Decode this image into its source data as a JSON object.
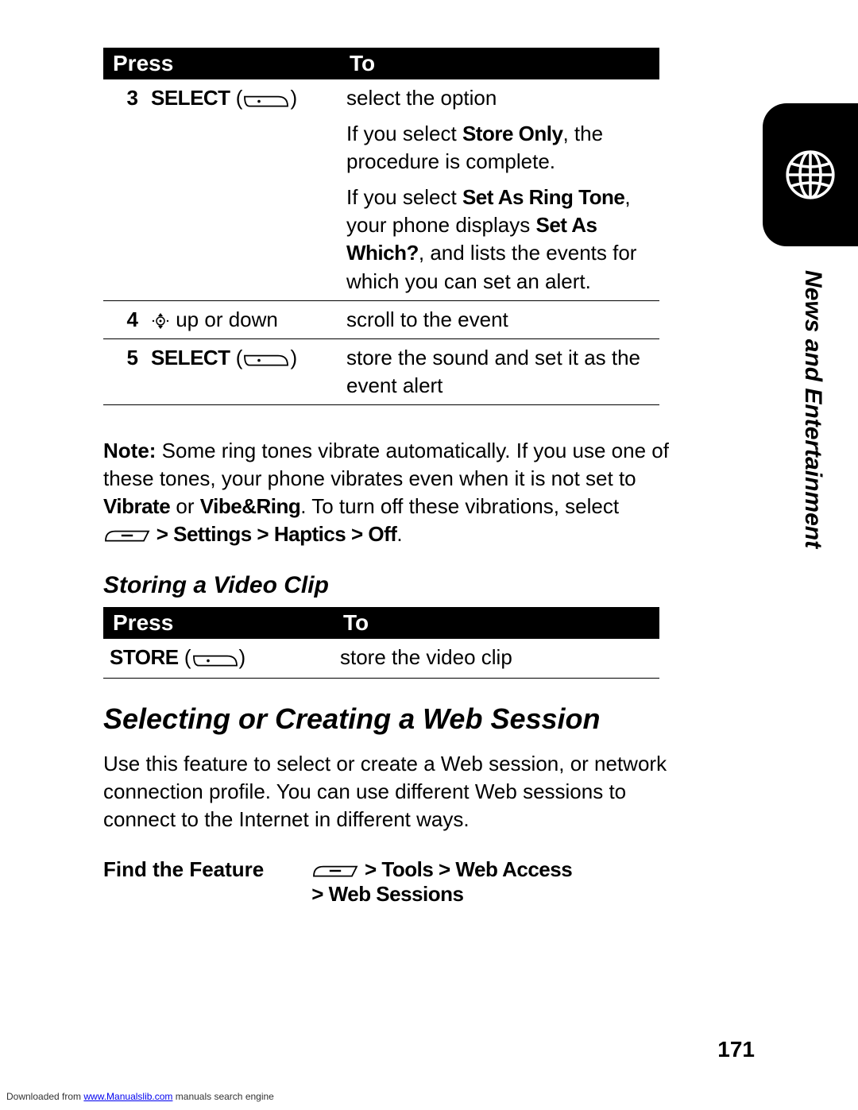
{
  "side_label": "News and Entertainment",
  "table1": {
    "head_press": "Press",
    "head_to": "To",
    "rows": [
      {
        "num": "3",
        "press_label": "SELECT",
        "to_line1": "select the option",
        "to_line2a": "If you select ",
        "to_line2b": "Store Only",
        "to_line2c": ", the procedure is complete.",
        "to_line3a": "If you select ",
        "to_line3b": "Set As Ring Tone",
        "to_line3c": ", your phone displays ",
        "to_line3d": "Set As Which?",
        "to_line3e": ", and lists the events for which you can set an alert."
      },
      {
        "num": "4",
        "press_suffix": " up or down",
        "to": "scroll to the event"
      },
      {
        "num": "5",
        "press_label": "SELECT",
        "to": "store the sound and set it as the event alert"
      }
    ]
  },
  "note": {
    "label": "Note:",
    "t1": " Some ring tones vibrate automatically. If you use one of these tones, your phone vibrates even when it is not set to ",
    "b1": "Vibrate",
    "t2": " or ",
    "b2": "Vibe&Ring",
    "t3": ". To turn off these vibrations, select ",
    "path": " > Settings > Haptics > Off",
    "t4": "."
  },
  "sub_heading": "Storing a Video Clip",
  "table2": {
    "head_press": "Press",
    "head_to": "To",
    "row": {
      "press_label": "STORE",
      "to": "store the video clip"
    }
  },
  "section_heading": "Selecting or Creating a Web Session",
  "section_para": "Use this feature to select or create a Web session, or network connection profile. You can use different Web sessions to connect to the Internet in different ways.",
  "find": {
    "label": "Find the Feature",
    "path1": " > Tools > Web Access",
    "path2": "> Web Sessions"
  },
  "page_number": "171",
  "footer": {
    "t1": "Downloaded from ",
    "link": "www.Manualslib.com",
    "t2": " manuals search engine"
  }
}
